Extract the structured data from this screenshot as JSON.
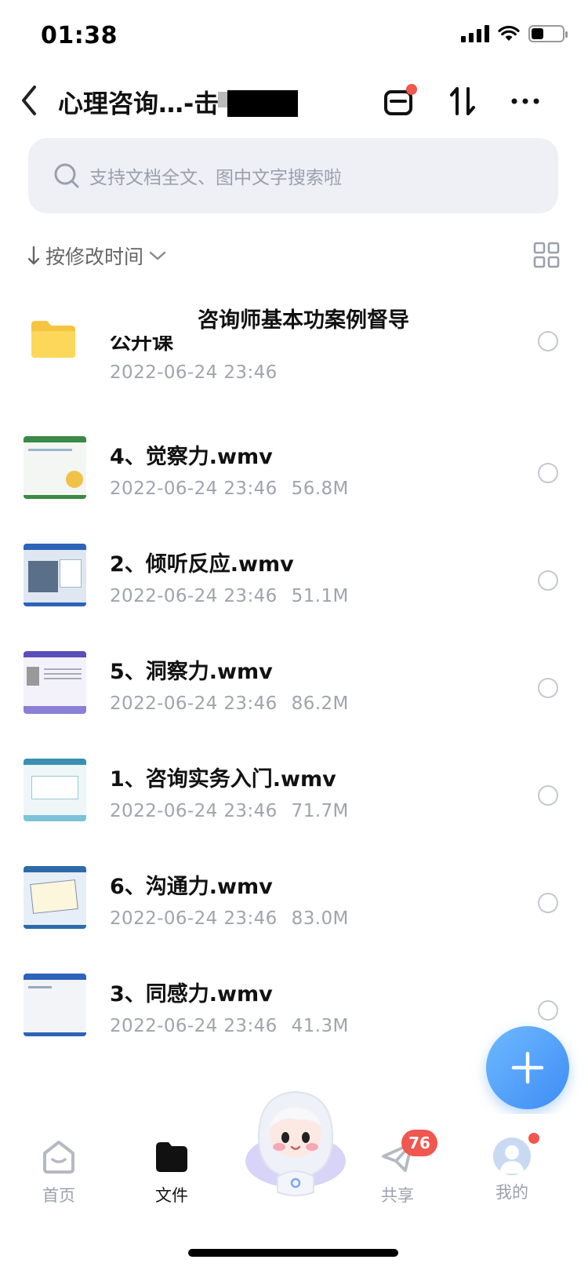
{
  "status_bar": {
    "time": "01:38"
  },
  "header": {
    "title": "心理咨询…-击"
  },
  "search": {
    "placeholder": "支持文档全文、图中文字搜索啦"
  },
  "sort": {
    "label": "按修改时间"
  },
  "files": [
    {
      "type": "folder",
      "name": "咨询师基本功案例督导",
      "name_sub": "公开课",
      "date": "2022-06-24 23:46",
      "size": ""
    },
    {
      "type": "video",
      "name": "4、觉察力.wmv",
      "date": "2022-06-24 23:46",
      "size": "56.8M",
      "accent": "#3a8a45"
    },
    {
      "type": "video",
      "name": "2、倾听反应.wmv",
      "date": "2022-06-24 23:46",
      "size": "51.1M",
      "accent": "#2d63b8"
    },
    {
      "type": "video",
      "name": "5、洞察力.wmv",
      "date": "2022-06-24 23:46",
      "size": "86.2M",
      "accent": "#5a4fb8"
    },
    {
      "type": "video",
      "name": "1、咨询实务入门.wmv",
      "date": "2022-06-24 23:46",
      "size": "71.7M",
      "accent": "#3a8fb3"
    },
    {
      "type": "video",
      "name": "6、沟通力.wmv",
      "date": "2022-06-24 23:46",
      "size": "83.0M",
      "accent": "#2f6aa8"
    },
    {
      "type": "video",
      "name": "3、同感力.wmv",
      "date": "2022-06-24 23:46",
      "size": "41.3M",
      "accent": "#2d63b8"
    }
  ],
  "nav": {
    "home": "首页",
    "files": "文件",
    "share": "共享",
    "share_badge": "76",
    "mine": "我的"
  },
  "colors": {
    "accent": "#3d8df5",
    "badge": "#f0574f",
    "meta": "#a0a4ab"
  }
}
